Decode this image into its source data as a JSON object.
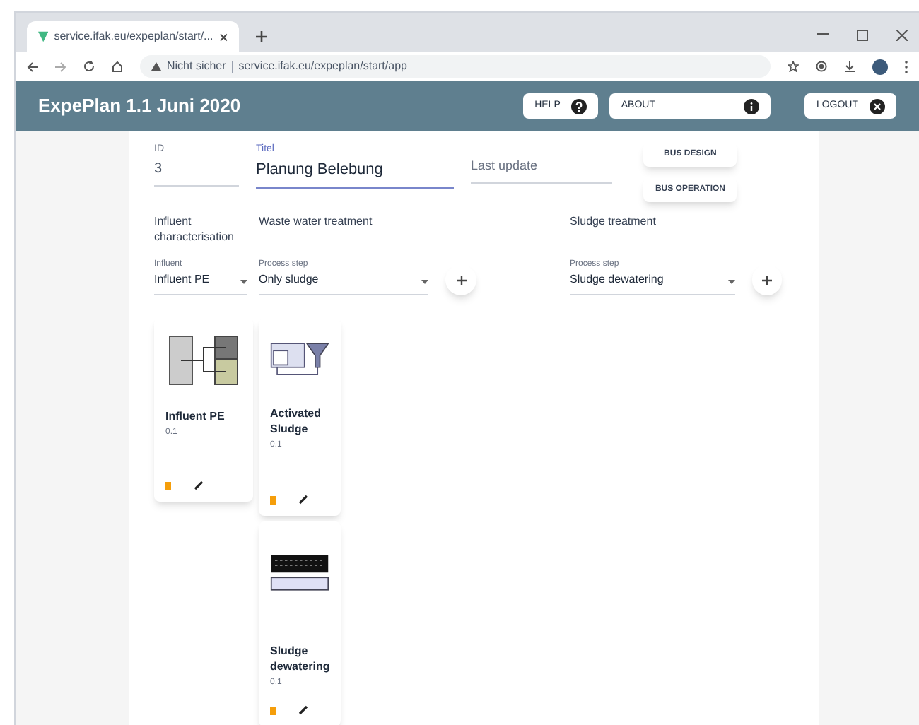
{
  "browser": {
    "tab_title": "service.ifak.eu/expeplan/start/...",
    "url_security": "Nicht sicher",
    "url": "service.ifak.eu/expeplan/start/app"
  },
  "app_bar": {
    "title": "ExpePlan 1.1 Juni 2020",
    "buttons": [
      {
        "label": "HELP"
      },
      {
        "label": "ABOUT"
      },
      {
        "label": "LOGOUT"
      }
    ]
  },
  "form": {
    "id": {
      "label": "ID",
      "value": "3"
    },
    "title": {
      "label": "Titel",
      "value": "Planung Belebung",
      "focused": true
    },
    "last_update": {
      "placeholder": "Last update"
    },
    "actions": [
      "BUS DESIGN",
      "BUS OPERATION"
    ]
  },
  "sections": [
    {
      "heading": "Influent characterisation",
      "select": {
        "label": "Influent",
        "value": "Influent PE"
      },
      "add_button": false
    },
    {
      "heading": "Waste water treatment",
      "select": {
        "label": "Process step",
        "value": "Only sludge"
      },
      "add_button": true
    },
    {
      "heading": "Sludge treatment",
      "select": {
        "label": "Process step",
        "value": "Sludge dewatering"
      },
      "add_button": true
    }
  ],
  "card_columns": [
    [
      {
        "kind": "influent",
        "name": "Influent PE",
        "version": "0.1"
      }
    ],
    [
      {
        "kind": "activated",
        "name": "Activated Sludge",
        "version": "0.1"
      },
      {
        "kind": "dewatering",
        "name": "Sludge dewatering",
        "version": "0.1"
      }
    ]
  ]
}
